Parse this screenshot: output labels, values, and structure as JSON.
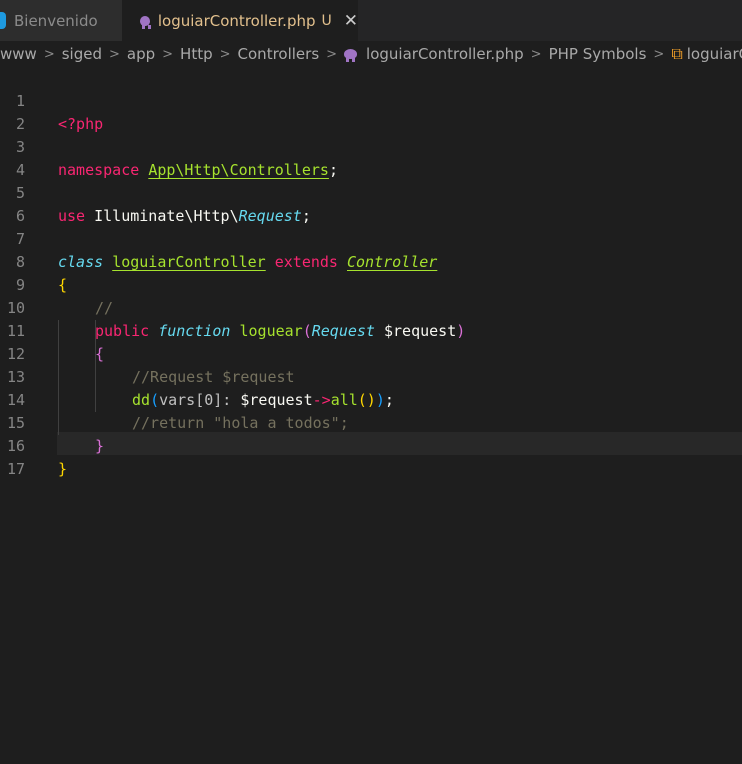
{
  "tabs": [
    {
      "label": "Bienvenido",
      "active": false
    },
    {
      "label": "loguiarController.php",
      "active": true,
      "status": "U",
      "close": "✕"
    }
  ],
  "breadcrumb": [
    "www",
    "siged",
    "app",
    "Http",
    "Controllers",
    "loguiarController.php",
    "PHP Symbols",
    "loguiarController"
  ],
  "breadcrumb_separator": ">",
  "colors": {
    "keyword": "#f92672",
    "storage": "#66d9ef",
    "entity": "#a6e22e",
    "comment": "#75715e",
    "bracket_1": "#ffd700",
    "bracket_2": "#da70d6",
    "bracket_3": "#179fff",
    "modified": "#e2c08d"
  },
  "editor": {
    "line_numbers": [
      "1",
      "2",
      "3",
      "4",
      "5",
      "6",
      "7",
      "8",
      "9",
      "10",
      "11",
      "12",
      "13",
      "14",
      "15",
      "16",
      "17"
    ],
    "code": {
      "l1": {
        "open_tag": "<?php"
      },
      "l3": {
        "kw": "namespace",
        "ns": "App\\Http\\Controllers",
        "semi": ";"
      },
      "l5": {
        "kw": "use",
        "ns": "Illuminate\\Http\\",
        "cls": "Request",
        "semi": ";"
      },
      "l7": {
        "kw1": "class",
        "name": "loguiarController",
        "kw2": "extends",
        "parent": "Controller"
      },
      "l8": {
        "brace": "{"
      },
      "l9": {
        "comment": "//"
      },
      "l10": {
        "kw1": "public",
        "kw2": "function",
        "fn": "loguear",
        "p_open": "(",
        "type": "Request",
        "var": "$request",
        "p_close": ")"
      },
      "l11": {
        "brace": "{"
      },
      "l12": {
        "comment": "//Request $request"
      },
      "l13": {
        "fn": "dd",
        "p1": "(",
        "arg": "vars[0]:",
        "var": "$request",
        "arrow": "->",
        "method": "all",
        "p3": "()",
        "p1c": ")",
        "semi": ";"
      },
      "l14": {
        "comment": "//return \"hola a todos\";"
      },
      "l15": {
        "brace": "}"
      },
      "l16": {
        "brace": "}"
      }
    }
  }
}
